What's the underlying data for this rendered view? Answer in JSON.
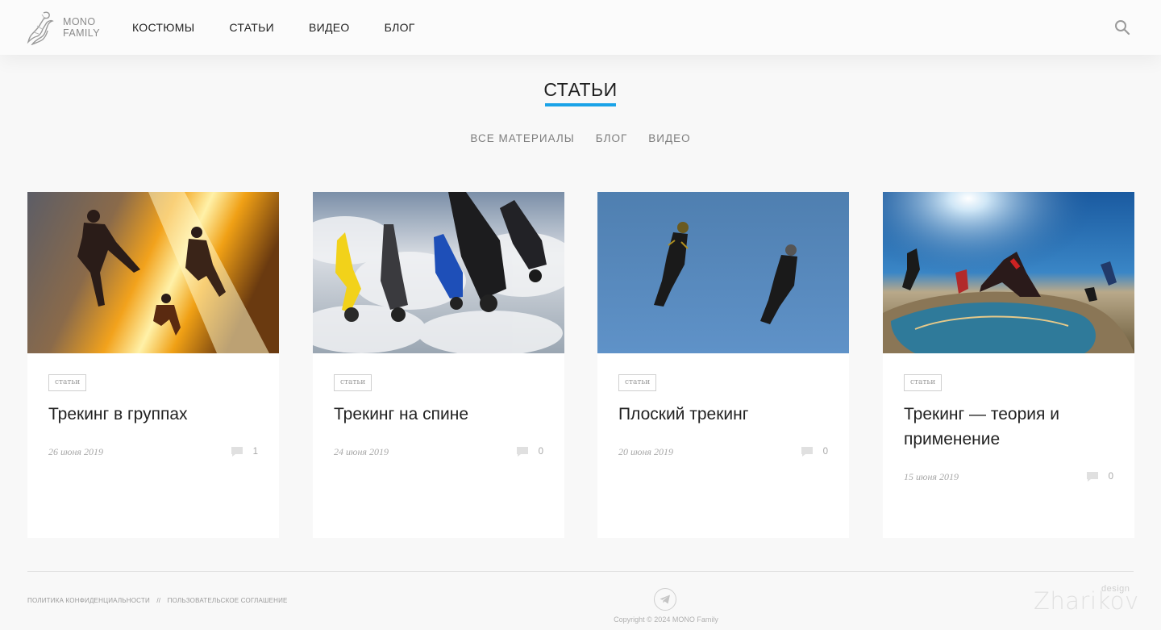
{
  "header": {
    "logo_line1": "MONO",
    "logo_line2": "FAMILY",
    "nav": [
      "КОСТЮМЫ",
      "СТАТЬИ",
      "ВИДЕО",
      "БЛОГ"
    ]
  },
  "page": {
    "title": "СТАТЬИ",
    "accent_color": "#1aa3e8",
    "filters": [
      "ВСЕ МАТЕРИАЛЫ",
      "БЛОГ",
      "ВИДЕО"
    ]
  },
  "cards": [
    {
      "tag": "статьи",
      "title": "Трекинг в группах",
      "date": "26 июня 2019",
      "comments": "1",
      "image": "skydivers-sunlight"
    },
    {
      "tag": "статьи",
      "title": "Трекинг на спине",
      "date": "24 июня 2019",
      "comments": "0",
      "image": "skydivers-over-clouds"
    },
    {
      "tag": "статьи",
      "title": "Плоский трекинг",
      "date": "20 июня 2019",
      "comments": "0",
      "image": "two-skydivers-blue-sky"
    },
    {
      "tag": "статьи",
      "title": "Трекинг — теория и применение",
      "date": "15 июня 2019",
      "comments": "0",
      "image": "skydivers-over-coast"
    }
  ],
  "footer": {
    "privacy": "ПОЛИТИКА КОНФИДЕНЦИАЛЬНОСТИ",
    "separator": "//",
    "agreement": "ПОЛЬЗОВАТЕЛЬСКОЕ СОГЛАШЕНИЕ",
    "copyright": "Copyright © 2024 MONO Family",
    "designer": "Zharikov",
    "designer_sub": "design"
  }
}
